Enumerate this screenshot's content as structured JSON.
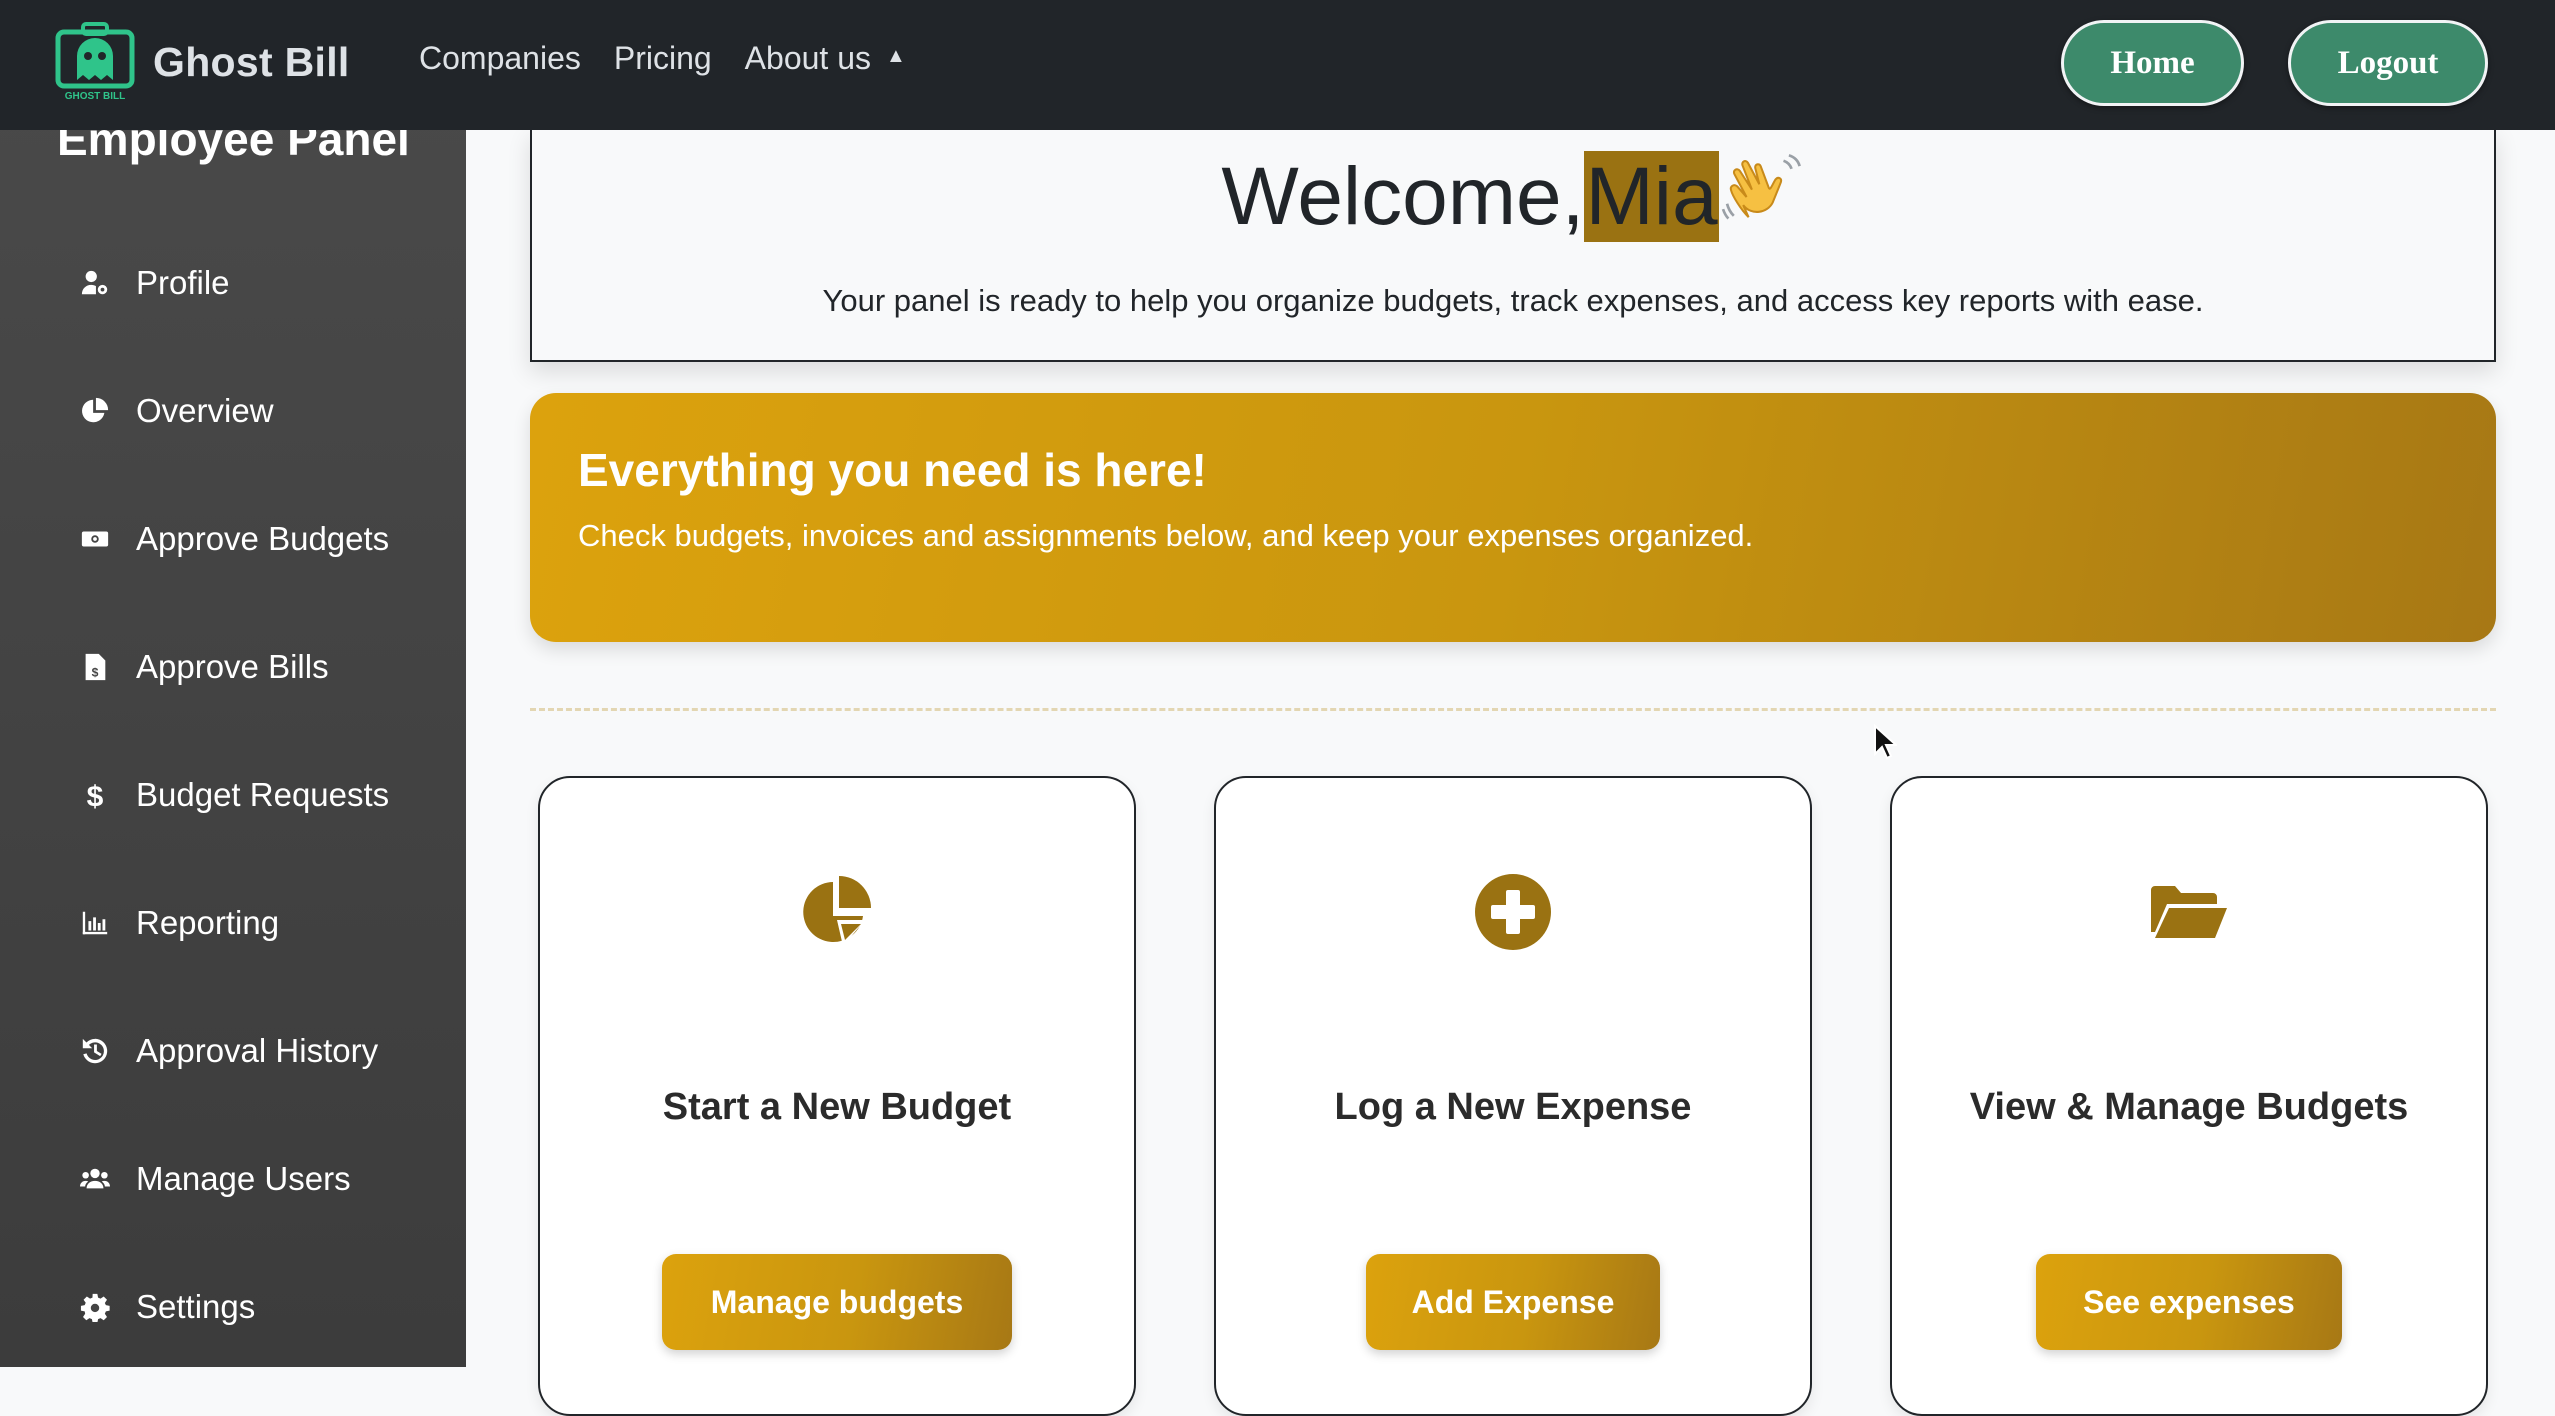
{
  "navbar": {
    "brand_name": "Ghost Bill",
    "logo_caption": "GHOST BILL",
    "links": [
      "Companies",
      "Pricing",
      "About us"
    ],
    "about_caret": "▲",
    "home_label": "Home",
    "logout_label": "Logout"
  },
  "sidebar": {
    "title": "Employee Panel",
    "items": [
      {
        "label": "Profile",
        "icon": "user-cog-icon"
      },
      {
        "label": "Overview",
        "icon": "pie-chart-icon"
      },
      {
        "label": "Approve Budgets",
        "icon": "money-bill-icon"
      },
      {
        "label": "Approve Bills",
        "icon": "invoice-dollar-icon"
      },
      {
        "label": "Budget Requests",
        "icon": "dollar-sign-icon"
      },
      {
        "label": "Reporting",
        "icon": "bar-chart-icon"
      },
      {
        "label": "Approval History",
        "icon": "history-icon"
      },
      {
        "label": "Manage Users",
        "icon": "users-icon"
      },
      {
        "label": "Settings",
        "icon": "gear-icon"
      }
    ]
  },
  "welcome": {
    "greeting": "Welcome,",
    "name": "Mia",
    "subtitle": "Your panel is ready to help you organize budgets, track expenses, and access key reports with ease."
  },
  "banner": {
    "title": "Everything you need is here!",
    "subtitle": "Check budgets, invoices and assignments below, and keep your expenses organized."
  },
  "cards": [
    {
      "title": "Start a New Budget",
      "button": "Manage budgets",
      "icon": "pie-chart-icon"
    },
    {
      "title": "Log a New Expense",
      "button": "Add Expense",
      "icon": "plus-circle-icon"
    },
    {
      "title": "View & Manage Budgets",
      "button": "See expenses",
      "icon": "folder-open-icon"
    }
  ],
  "colors": {
    "navbar_bg": "#212529",
    "nav_button": "#3d8a6b",
    "accent_gold": "#c9960f",
    "icon_gold": "#9a7212",
    "sidebar_bg": "#444444"
  }
}
